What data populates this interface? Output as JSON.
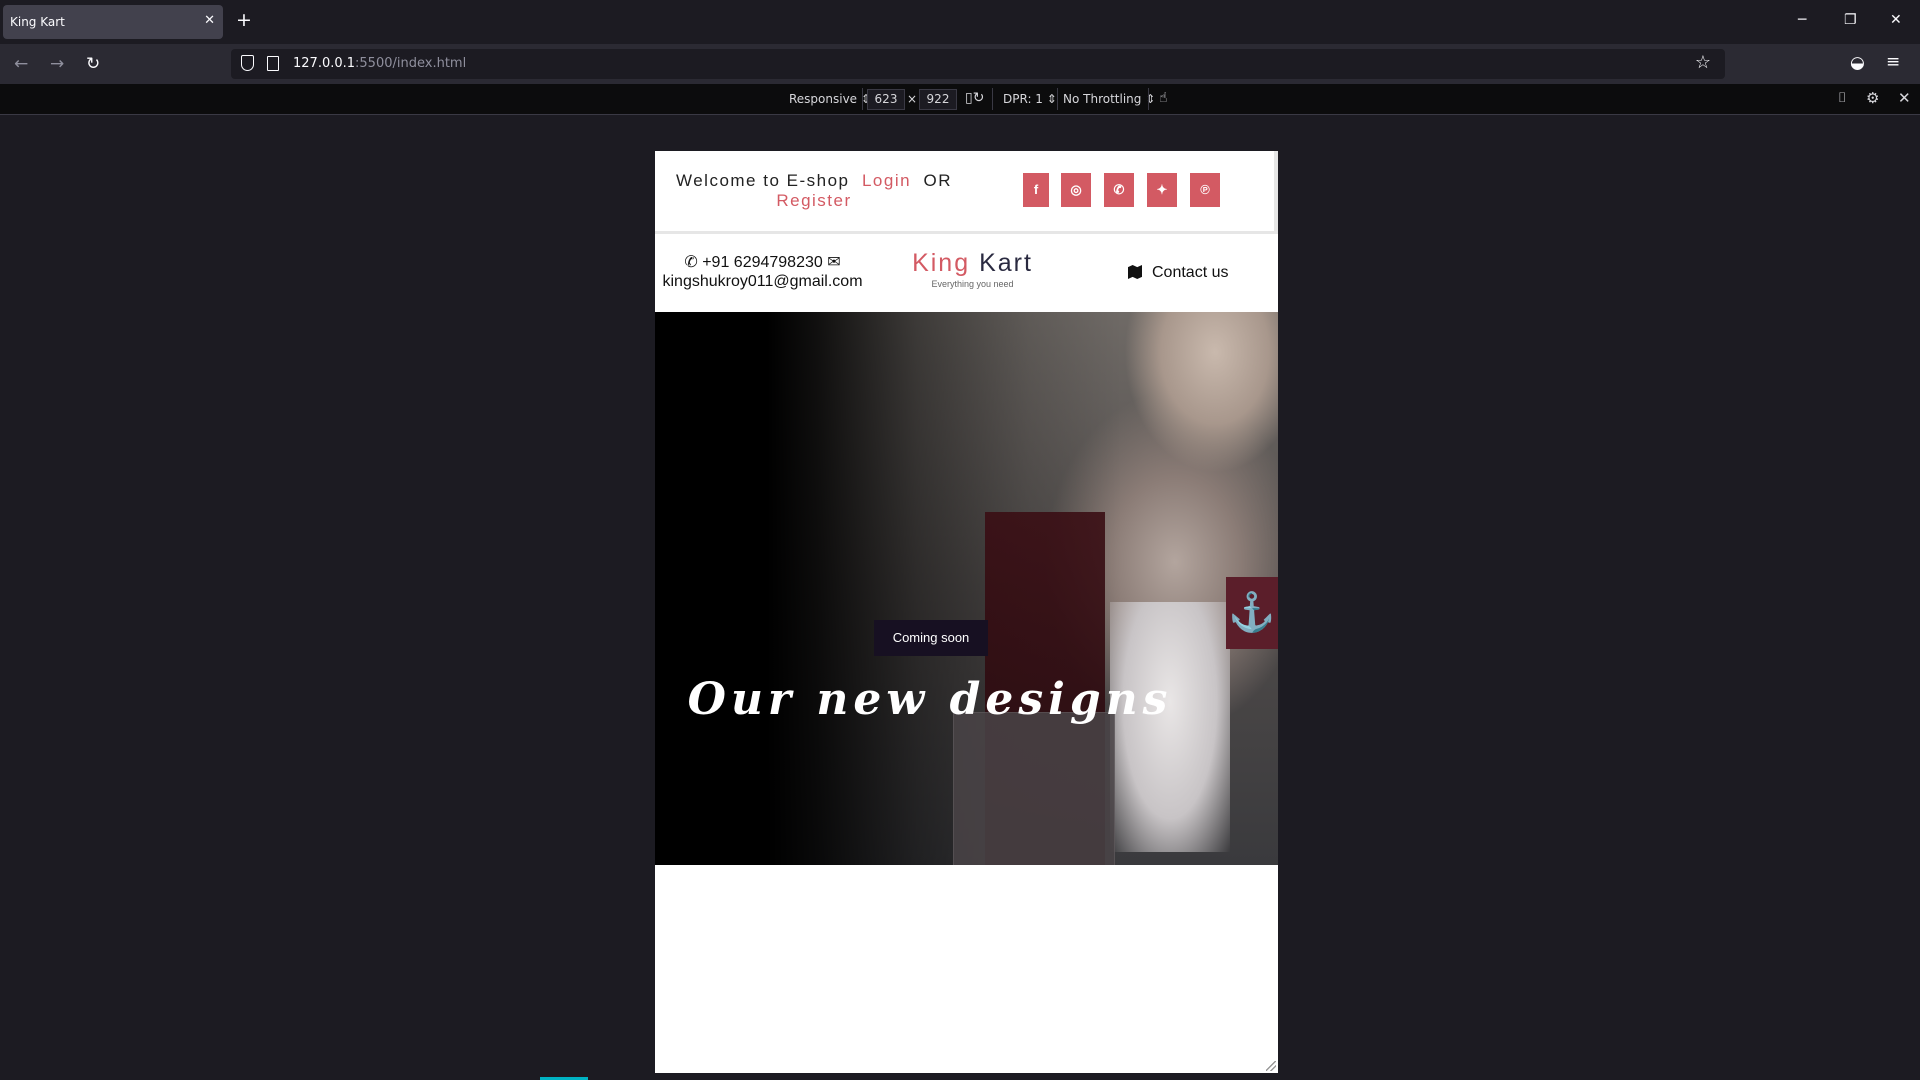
{
  "browser": {
    "tab_title": "King Kart",
    "new_tab": "+",
    "url_host": "127.0.0.1",
    "url_path": ":5500/index.html"
  },
  "responsive_toolbar": {
    "device": "Responsive ⇕",
    "width": "623",
    "times": "×",
    "height": "922",
    "dpr": "DPR: 1 ⇕",
    "throttling": "No Throttling ⇕"
  },
  "site": {
    "welcome_text": "Welcome to E-shop",
    "login_label": "Login",
    "or_text": "OR",
    "register_label": "Register",
    "phone": "+91 6294798230",
    "email": "kingshukroy011@gmail.com",
    "brand_first": "King",
    "brand_second": "Kart",
    "tagline": "Everything you need",
    "contact_label": "Contact us",
    "social": [
      {
        "icon": "facebook-icon",
        "glyph": "f"
      },
      {
        "icon": "instagram-icon",
        "glyph": "◎"
      },
      {
        "icon": "whatsapp-icon",
        "glyph": "✆"
      },
      {
        "icon": "twitter-icon",
        "glyph": "✦"
      },
      {
        "icon": "pinterest-icon",
        "glyph": "℗"
      }
    ],
    "hero": {
      "badge": "Coming soon",
      "headline": "Our new designs",
      "anchor_glyph": "⚓"
    }
  },
  "colors": {
    "accent": "#d35a63",
    "brand_dark": "#2a2a40",
    "anchor_bg": "#5b1e2a",
    "badge_bg": "#171022"
  }
}
